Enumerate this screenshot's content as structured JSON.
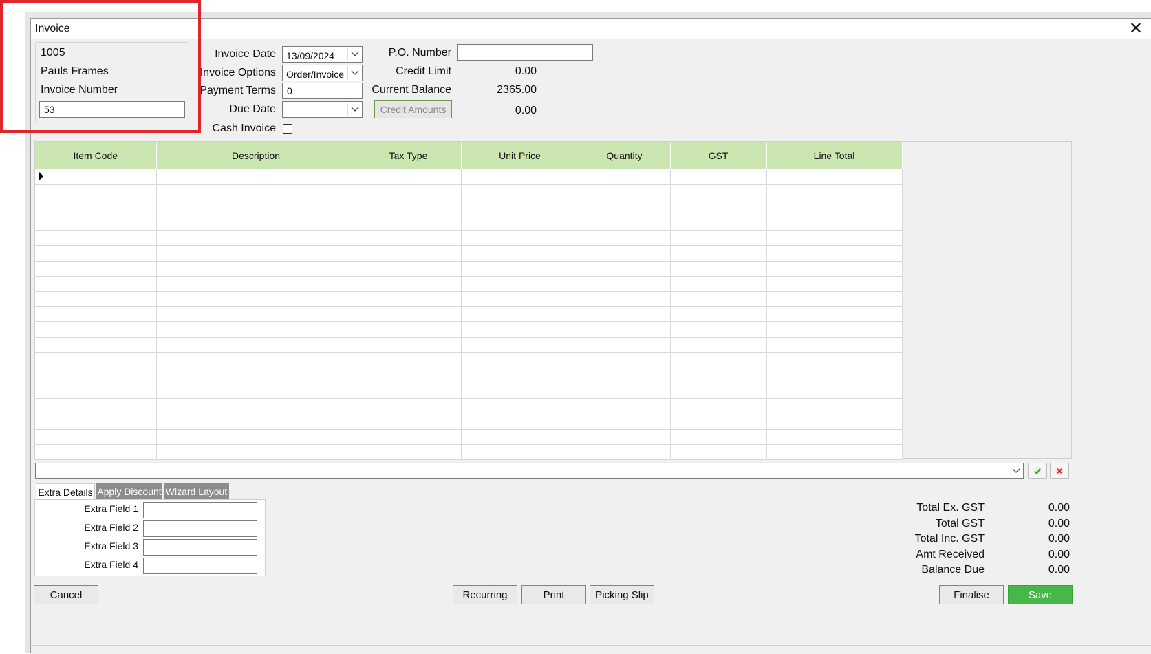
{
  "window": {
    "title": "Invoice",
    "close_glyph": "✕"
  },
  "customer": {
    "code": "1005",
    "name": "Pauls Frames",
    "invoice_number_label": "Invoice Number",
    "invoice_number": "53"
  },
  "header_form": {
    "invoice_date_label": "Invoice Date",
    "invoice_date": "13/09/2024",
    "invoice_options_label": "Invoice Options",
    "invoice_options": "Order/Invoice",
    "payment_terms_label": "Payment Terms",
    "payment_terms": "0",
    "due_date_label": "Due Date",
    "due_date": "",
    "cash_invoice_label": "Cash Invoice",
    "cash_invoice_checked": false,
    "po_number_label": "P.O. Number",
    "po_number": "",
    "credit_limit_label": "Credit Limit",
    "credit_limit": "0.00",
    "current_balance_label": "Current Balance",
    "current_balance": "2365.00",
    "credit_amounts_button": "Credit Amounts",
    "credit_amounts_value": "0.00"
  },
  "grid": {
    "columns": [
      "Item Code",
      "Description",
      "Tax Type",
      "Unit Price",
      "Quantity",
      "GST",
      "Line Total"
    ],
    "header_color": "#cbe6b0"
  },
  "tabs": {
    "items": [
      "Extra Details",
      "Apply Discount",
      "Wizard Layout"
    ],
    "active": "Extra Details"
  },
  "extra_details": {
    "field1_label": "Extra Field 1",
    "field2_label": "Extra Field 2",
    "field3_label": "Extra Field 3",
    "field4_label": "Extra Field 4"
  },
  "totals": {
    "total_ex_gst_label": "Total Ex. GST",
    "total_ex_gst": "0.00",
    "total_gst_label": "Total GST",
    "total_gst": "0.00",
    "total_inc_gst_label": "Total Inc. GST",
    "total_inc_gst": "0.00",
    "amt_received_label": "Amt Received",
    "amt_received": "0.00",
    "balance_due_label": "Balance Due",
    "balance_due": "0.00"
  },
  "buttons": {
    "cancel": "Cancel",
    "recurring": "Recurring",
    "print": "Print",
    "picking_slip": "Picking Slip",
    "finalise": "Finalise",
    "save": "Save"
  },
  "colors": {
    "accent_green": "#48b74a",
    "highlight_red": "#e0252b"
  },
  "icons": {
    "accept": "green-check-icon",
    "reject": "red-cross-icon",
    "dropdown": "chevron-down-icon"
  }
}
